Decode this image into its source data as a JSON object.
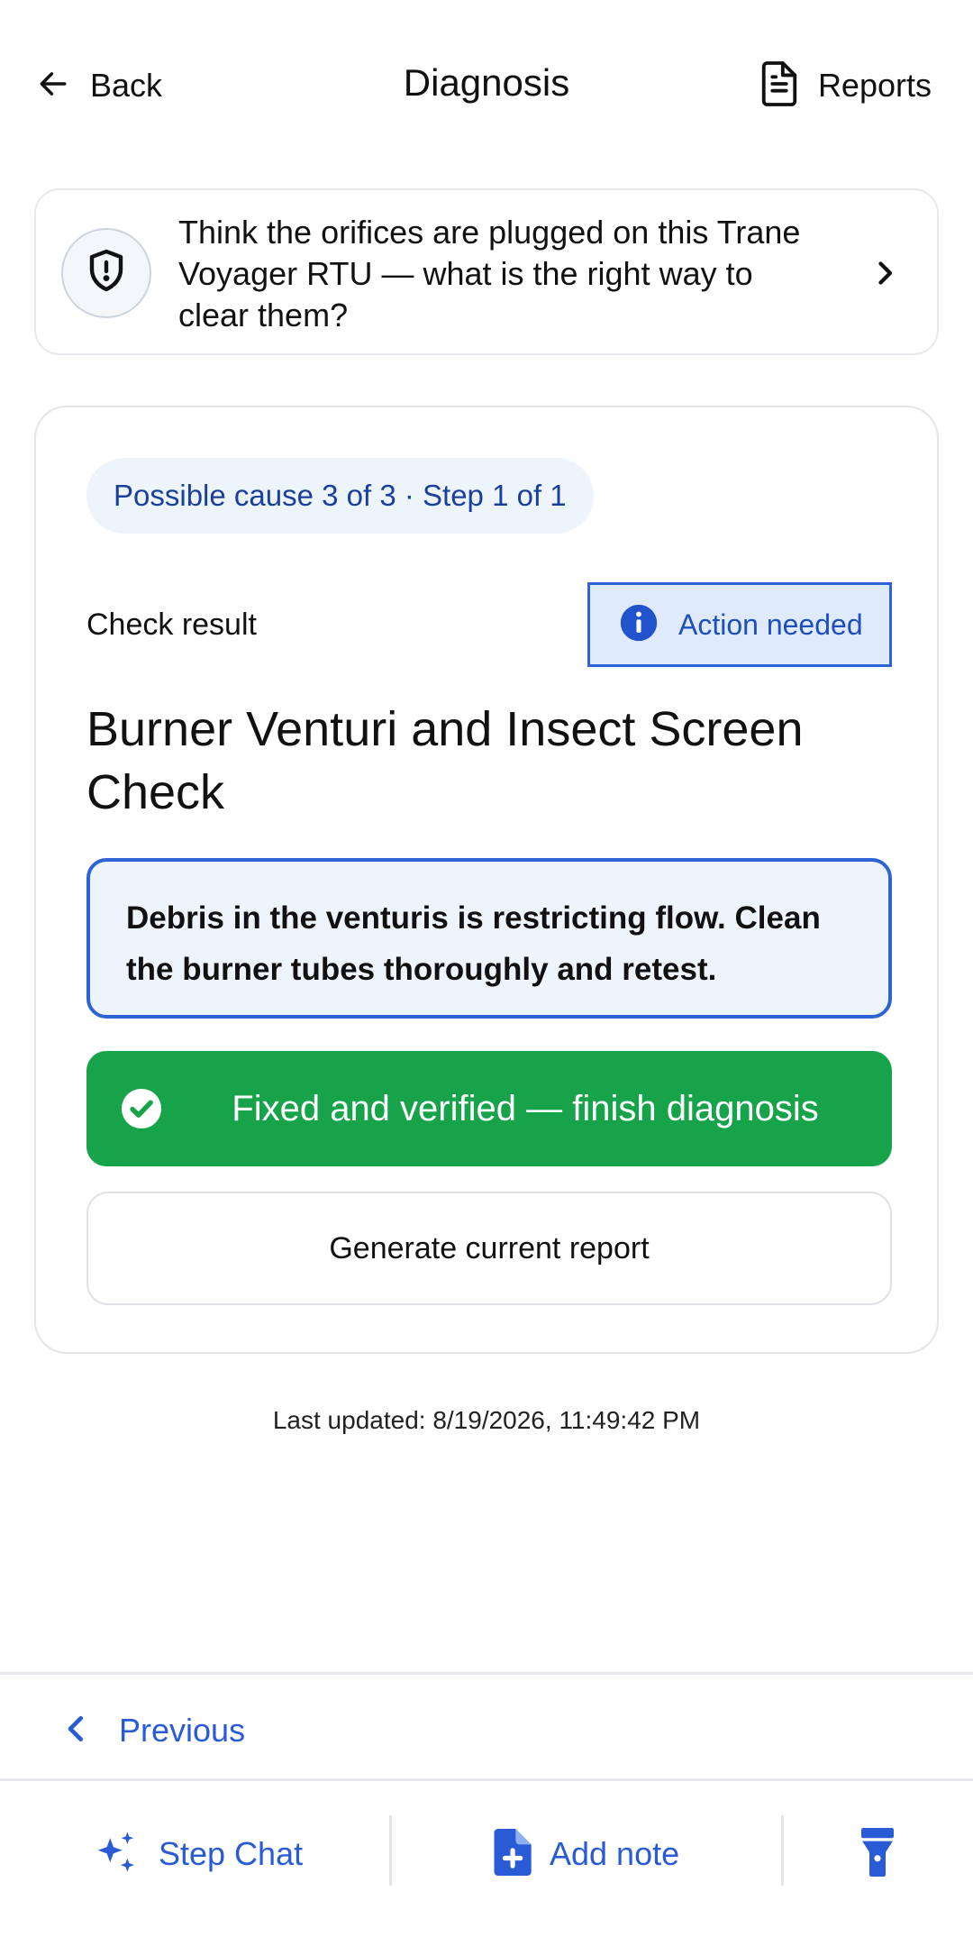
{
  "header": {
    "back_label": "Back",
    "title": "Diagnosis",
    "reports_label": "Reports"
  },
  "question": {
    "text": "Think the orifices are plugged on this Trane Voyager RTU — what is the right way to clear them?"
  },
  "step_card": {
    "progress": "Possible cause 3 of 3 · Step 1 of 1",
    "check_label": "Check result",
    "status_badge": "Action needed",
    "title": "Burner Venturi and Insect Screen Check",
    "result_text": "Debris in the venturis is restricting flow. Clean the burner tubes thoroughly and retest.",
    "primary_button": "Fixed and verified — finish diagnosis",
    "secondary_button": "Generate current report"
  },
  "last_updated": "Last updated: 8/19/2026, 11:49:42 PM",
  "footer": {
    "previous_label": "Previous",
    "step_chat_label": "Step Chat",
    "add_note_label": "Add note"
  },
  "icons": {
    "back": "arrow-left-icon",
    "reports": "document-icon",
    "question": "shield-alert-icon",
    "question_chevron": "chevron-right-icon",
    "status": "info-icon",
    "primary": "check-circle-icon",
    "previous": "chevron-left-icon",
    "step_chat": "sparkles-icon",
    "add_note": "file-plus-icon",
    "flashlight": "flashlight-icon"
  },
  "colors": {
    "accent_blue": "#2a5bd7",
    "badge_bg": "#dfeafd",
    "success_green": "#17a34a",
    "pill_bg": "#edf4fc"
  }
}
